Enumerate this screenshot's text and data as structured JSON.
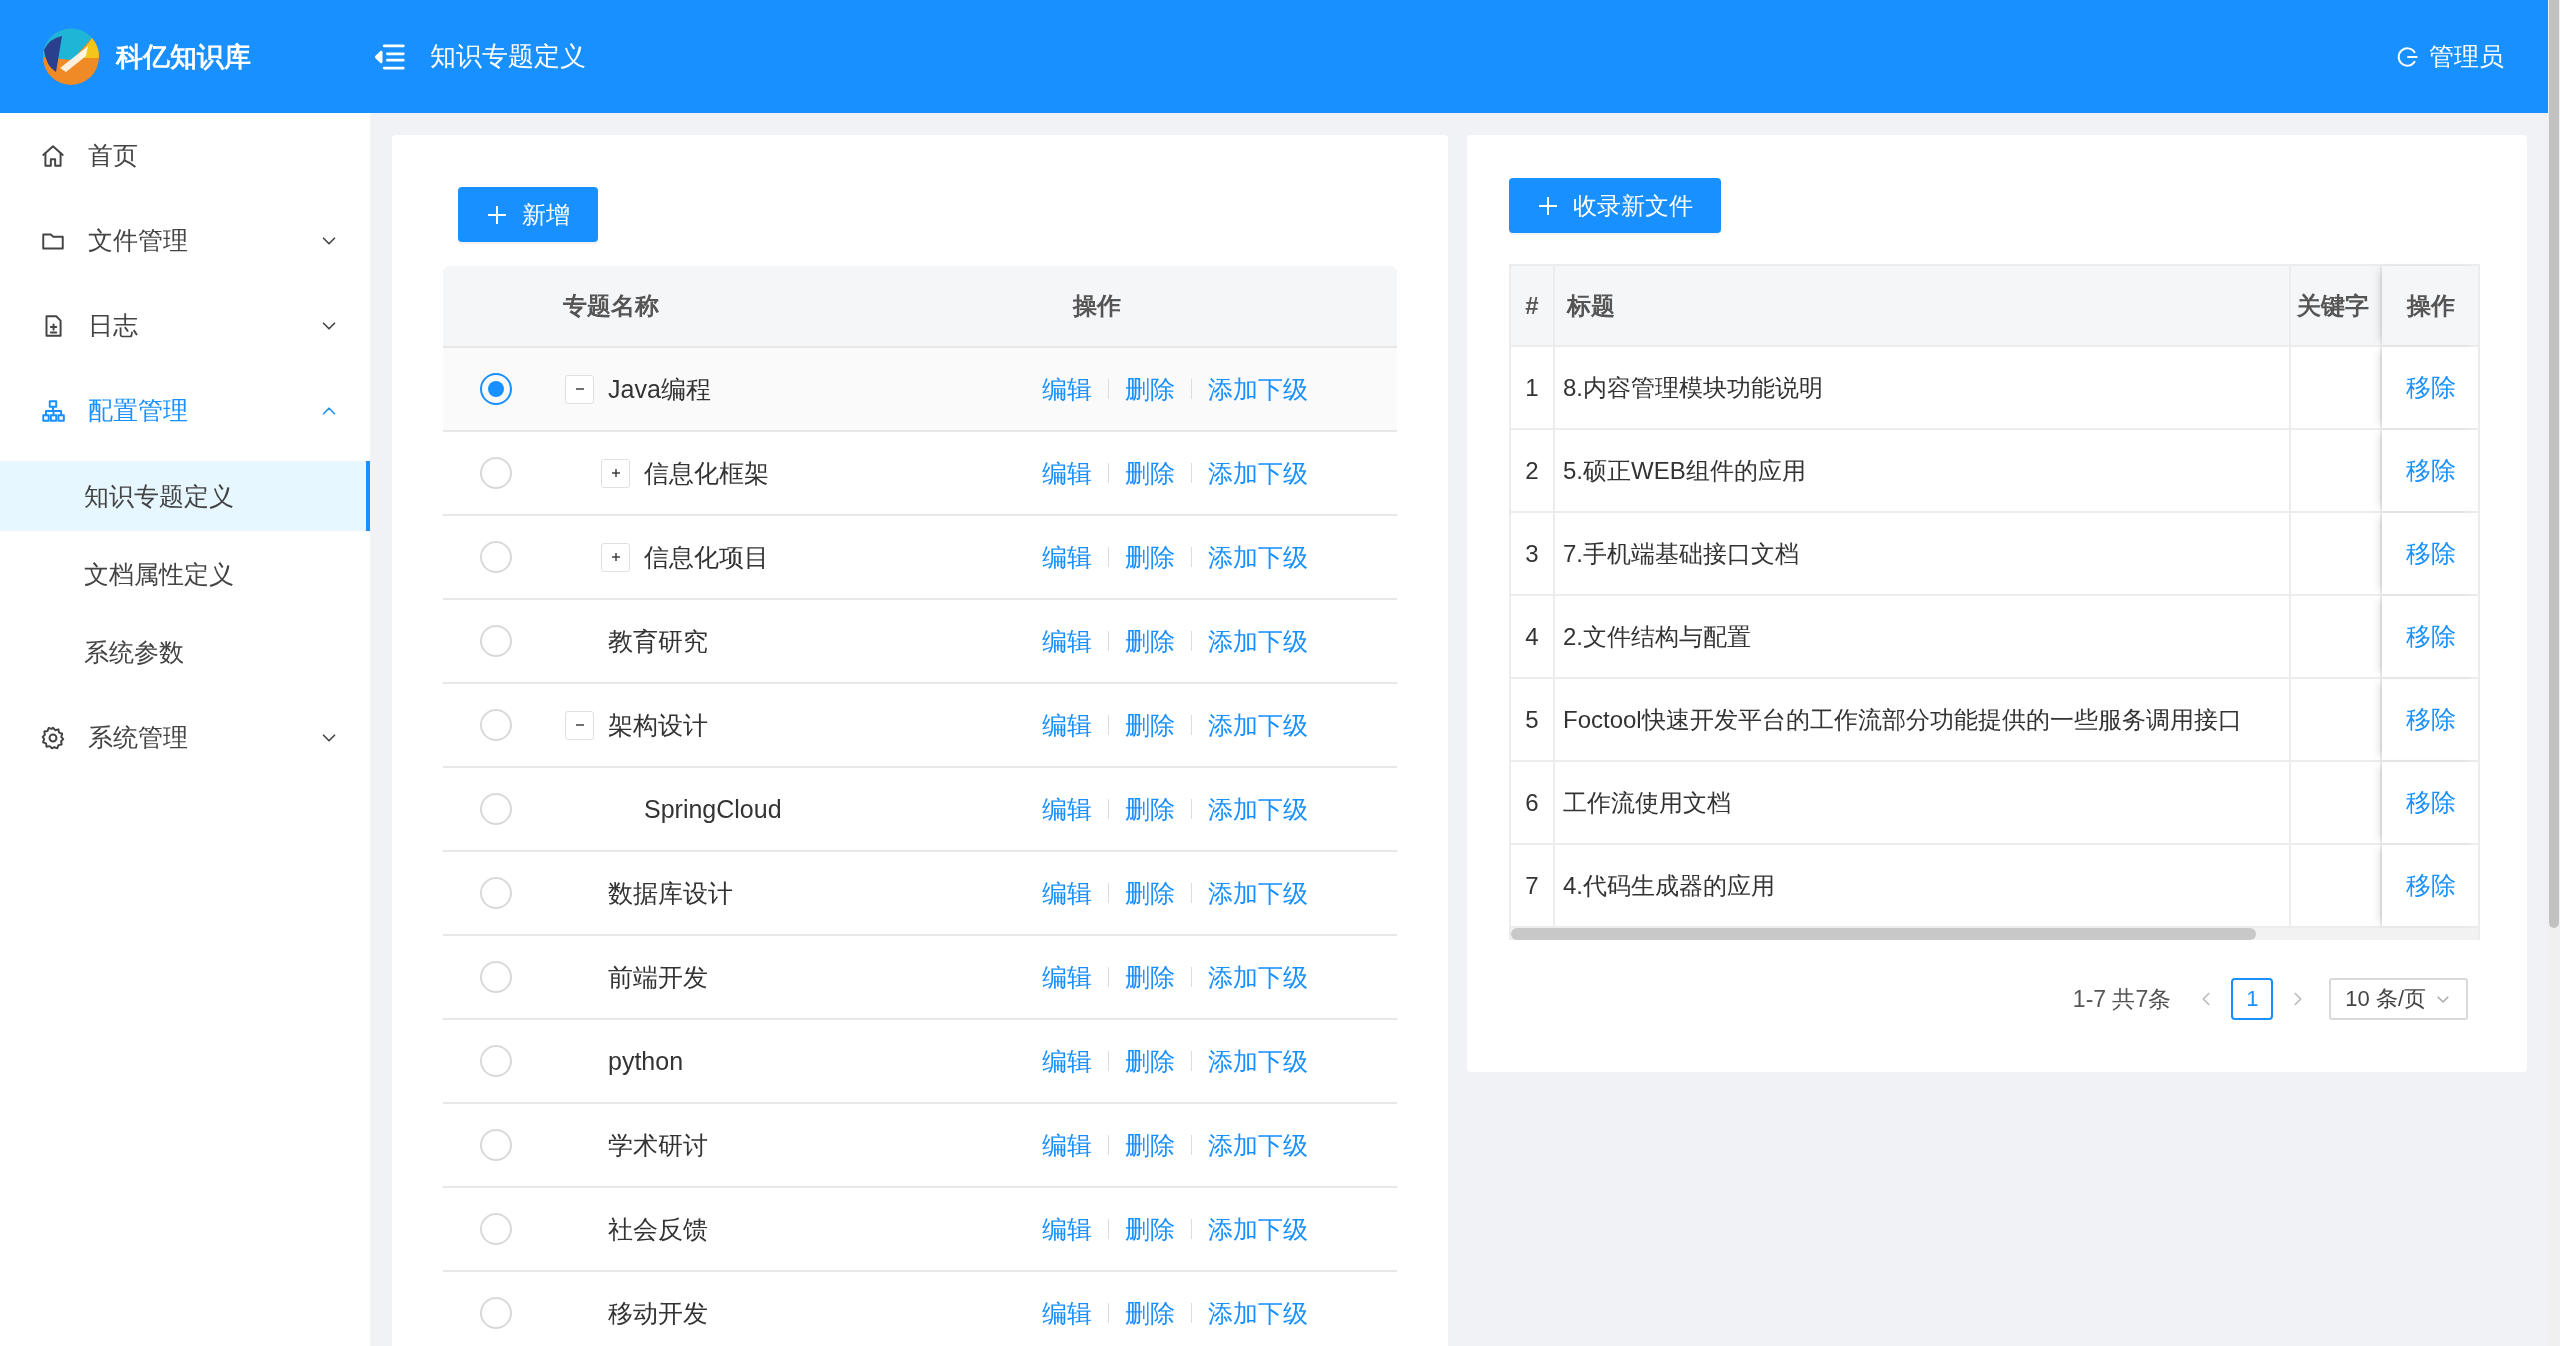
{
  "header": {
    "app_name": "科亿知识库",
    "page_title": "知识专题定义",
    "user": "管理员"
  },
  "sidebar": {
    "items": [
      {
        "label": "首页",
        "selected": false
      },
      {
        "label": "文件管理",
        "selected": false,
        "expanded": false
      },
      {
        "label": "日志",
        "selected": false,
        "expanded": false
      },
      {
        "label": "配置管理",
        "selected": true,
        "expanded": true,
        "children": [
          {
            "label": "知识专题定义",
            "selected": true
          },
          {
            "label": "文档属性定义",
            "selected": false
          },
          {
            "label": "系统参数",
            "selected": false
          }
        ]
      },
      {
        "label": "系统管理",
        "selected": false,
        "expanded": false
      }
    ]
  },
  "topic_panel": {
    "add_button": "新增",
    "columns": [
      "专题名称",
      "操作"
    ],
    "rows": [
      {
        "name": "Java编程",
        "selected": true,
        "expanded": true,
        "actions": [
          "编辑",
          "删除",
          "添加下级"
        ],
        "children": [
          {
            "name": "信息化框架",
            "selected": false,
            "expanded": false,
            "actions": [
              "编辑",
              "删除",
              "添加下级"
            ]
          },
          {
            "name": "信息化项目",
            "selected": false,
            "expanded": false,
            "actions": [
              "编辑",
              "删除",
              "添加下级"
            ]
          }
        ]
      },
      {
        "name": "教育研究",
        "selected": false,
        "actions": [
          "编辑",
          "删除",
          "添加下级"
        ]
      },
      {
        "name": "架构设计",
        "selected": false,
        "expanded": true,
        "actions": [
          "编辑",
          "删除",
          "添加下级"
        ],
        "children": [
          {
            "name": "SpringCloud",
            "selected": false,
            "actions": [
              "编辑",
              "删除",
              "添加下级"
            ]
          }
        ]
      },
      {
        "name": "数据库设计",
        "selected": false,
        "actions": [
          "编辑",
          "删除",
          "添加下级"
        ]
      },
      {
        "name": "前端开发",
        "selected": false,
        "actions": [
          "编辑",
          "删除",
          "添加下级"
        ]
      },
      {
        "name": "python",
        "selected": false,
        "actions": [
          "编辑",
          "删除",
          "添加下级"
        ]
      },
      {
        "name": "学术研讨",
        "selected": false,
        "actions": [
          "编辑",
          "删除",
          "添加下级"
        ]
      },
      {
        "name": "社会反馈",
        "selected": false,
        "actions": [
          "编辑",
          "删除",
          "添加下级"
        ]
      },
      {
        "name": "移动开发",
        "selected": false,
        "actions": [
          "编辑",
          "删除",
          "添加下级"
        ]
      }
    ]
  },
  "file_panel": {
    "add_button": "收录新文件",
    "columns": [
      "#",
      "标题",
      "关键字",
      "操作"
    ],
    "rows": [
      {
        "index": "1",
        "title": "8.内容管理模块功能说明",
        "action": "移除"
      },
      {
        "index": "2",
        "title": "5.硕正WEB组件的应用",
        "action": "移除"
      },
      {
        "index": "3",
        "title": "7.手机端基础接口文档",
        "action": "移除"
      },
      {
        "index": "4",
        "title": "2.文件结构与配置",
        "action": "移除"
      },
      {
        "index": "5",
        "title": "Foctool快速开发平台的工作流部分功能提供的一些服务调用接口",
        "action": "移除"
      },
      {
        "index": "6",
        "title": "工作流使用文档",
        "action": "移除"
      },
      {
        "index": "7",
        "title": "4.代码生成器的应用",
        "action": "移除"
      }
    ],
    "pagination": {
      "summary": "1-7 共7条",
      "pages": [
        {
          "label": "1",
          "selected": true
        }
      ],
      "page_size": "10 条/页"
    }
  }
}
